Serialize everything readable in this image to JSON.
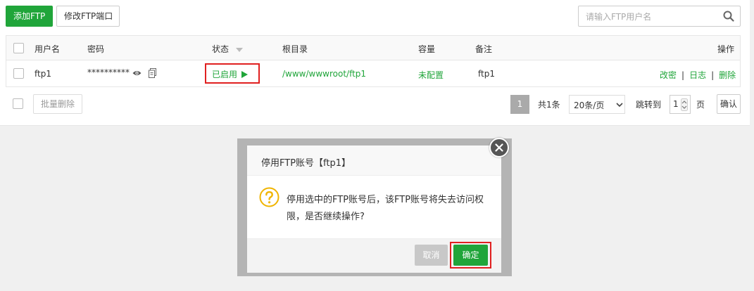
{
  "toolbar": {
    "add_label": "添加FTP",
    "edit_port_label": "修改FTP端口",
    "search_placeholder": "请输入FTP用户名"
  },
  "table": {
    "headers": {
      "username": "用户名",
      "password": "密码",
      "status": "状态",
      "root": "根目录",
      "capacity": "容量",
      "remark": "备注",
      "actions": "操作"
    },
    "rows": [
      {
        "username": "ftp1",
        "password": "**********",
        "status": "已启用",
        "root": "/www/wwwroot/ftp1",
        "capacity": "未配置",
        "remark": "ftp1",
        "action_edit": "改密",
        "action_log": "日志",
        "action_delete": "删除"
      }
    ]
  },
  "footer": {
    "batch_delete": "批量删除",
    "page_current": "1",
    "total": "共1条",
    "per_page": "20条/页",
    "jump_label": "跳转到",
    "jump_value": "1",
    "page_unit": "页",
    "confirm": "确认"
  },
  "dialog": {
    "title": "停用FTP账号【ftp1】",
    "message": "停用选中的FTP账号后，该FTP账号将失去访问权限，是否继续操作?",
    "cancel": "取消",
    "ok": "确定"
  },
  "colors": {
    "accent": "#20a53a",
    "highlight": "#e02020"
  }
}
